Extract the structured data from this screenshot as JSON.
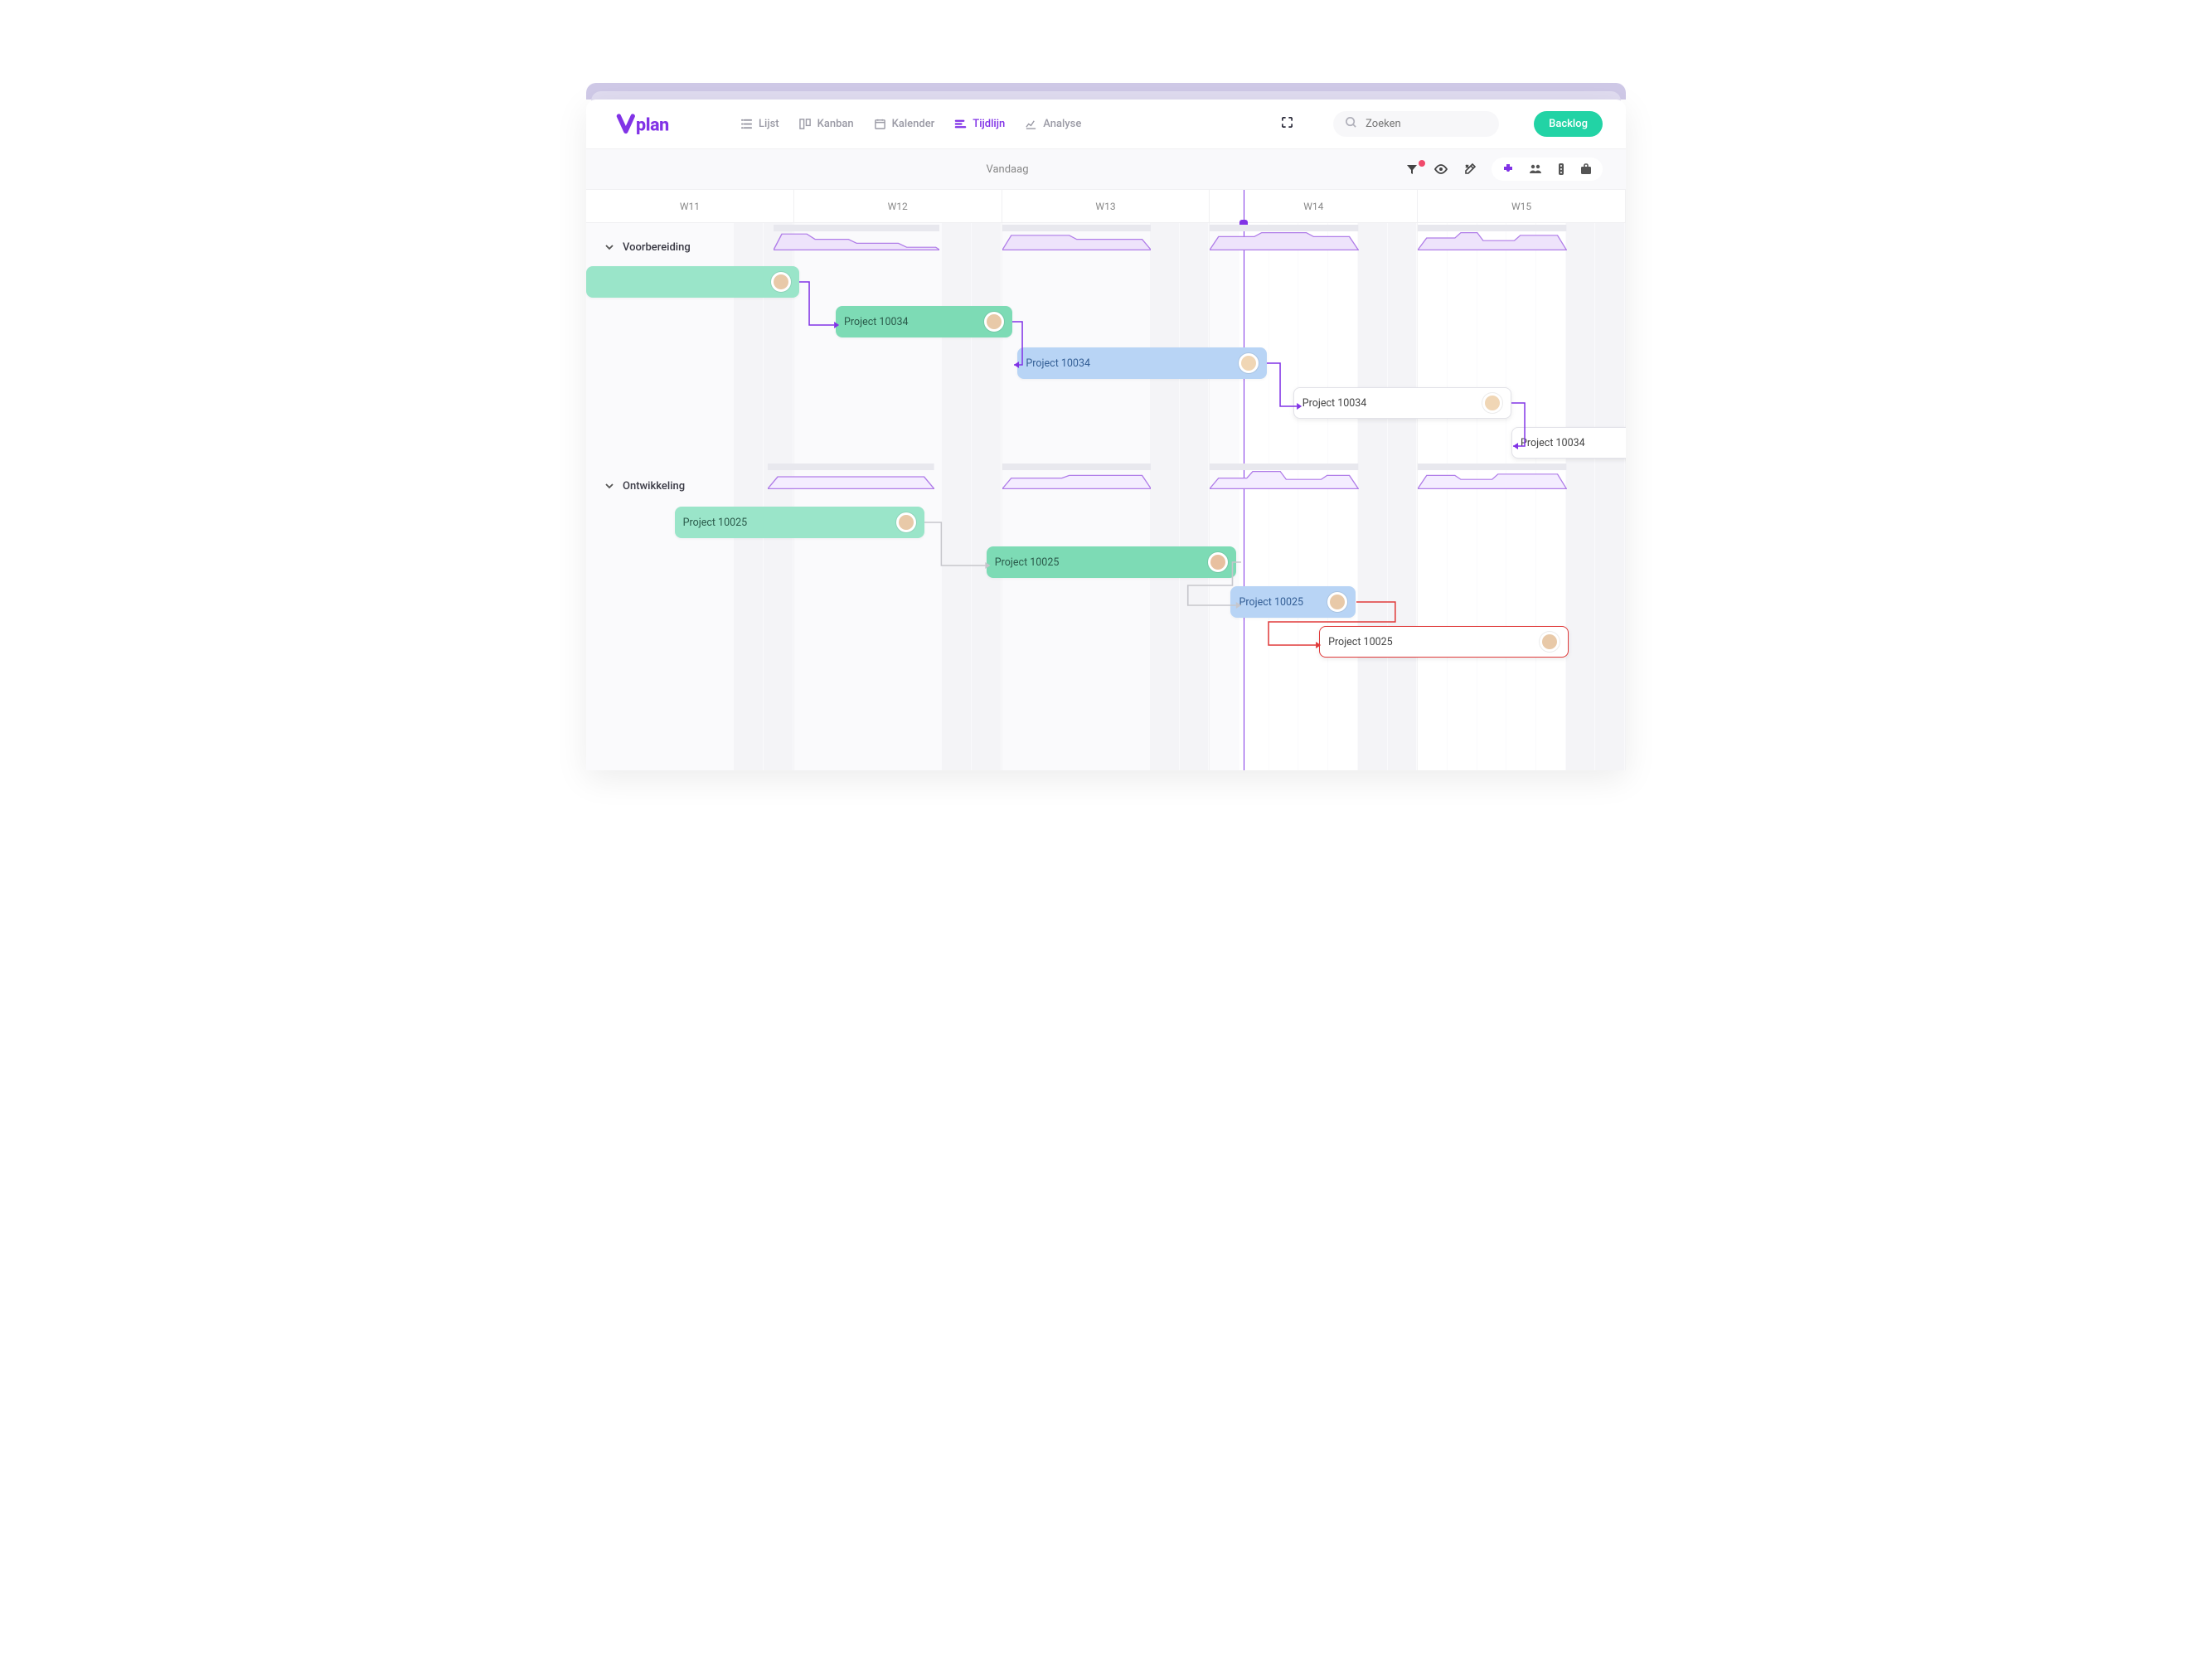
{
  "logo": "vplan",
  "nav": {
    "lijst": "Lijst",
    "kanban": "Kanban",
    "kalender": "Kalender",
    "tijdlijn": "Tijdlijn",
    "analyse": "Analyse"
  },
  "search": {
    "placeholder": "Zoeken"
  },
  "backlog_btn": "Backlog",
  "toolbar": {
    "today": "Vandaag"
  },
  "weeks": [
    "W11",
    "W12",
    "W13",
    "W14",
    "W15"
  ],
  "groups": {
    "g1": {
      "name": "Voorbereiding"
    },
    "g2": {
      "name": "Ontwikkeling"
    }
  },
  "tasks": {
    "t1a": {
      "label": ""
    },
    "t1b": {
      "label": "Project 10034"
    },
    "t1c": {
      "label": "Project 10034"
    },
    "t1d": {
      "label": "Project 10034"
    },
    "t1e": {
      "label": "Project 10034"
    },
    "t2a": {
      "label": "Project 10025"
    },
    "t2b": {
      "label": "Project 10025"
    },
    "t2c": {
      "label": "Project 10025"
    },
    "t2d": {
      "label": "Project 10025"
    }
  }
}
